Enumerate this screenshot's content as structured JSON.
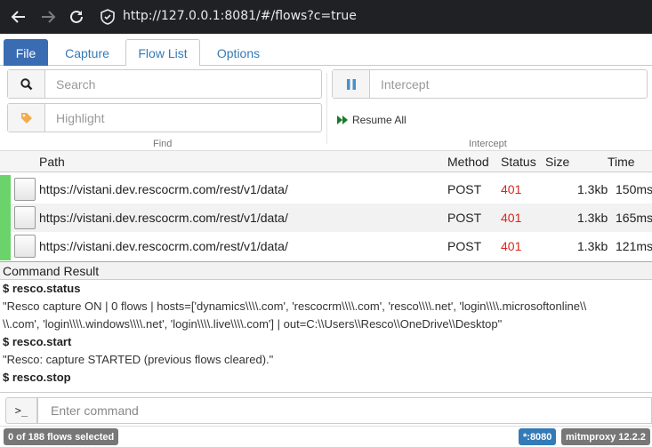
{
  "browser": {
    "url": "http://127.0.0.1:8081/#/flows?c=true"
  },
  "tabs": [
    {
      "label": "File"
    },
    {
      "label": "Capture"
    },
    {
      "label": "Flow List"
    },
    {
      "label": "Options"
    }
  ],
  "find": {
    "search_placeholder": "Search",
    "highlight_placeholder": "Highlight",
    "group_label": "Find"
  },
  "intercept": {
    "placeholder": "Intercept",
    "resume_label": "Resume All",
    "group_label": "Intercept"
  },
  "flows": {
    "columns": {
      "path": "Path",
      "method": "Method",
      "status": "Status",
      "size": "Size",
      "time": "Time"
    },
    "rows": [
      {
        "path": "https://vistani.dev.rescocrm.com/rest/v1/data/",
        "method": "POST",
        "status": "401",
        "size": "1.3kb",
        "time": "150ms"
      },
      {
        "path": "https://vistani.dev.rescocrm.com/rest/v1/data/",
        "method": "POST",
        "status": "401",
        "size": "1.3kb",
        "time": "165ms"
      },
      {
        "path": "https://vistani.dev.rescocrm.com/rest/v1/data/",
        "method": "POST",
        "status": "401",
        "size": "1.3kb",
        "time": "121ms"
      }
    ]
  },
  "command": {
    "header": "Command Result",
    "lines": [
      {
        "cmd": "$ resco.status"
      },
      {
        "text": "\"Resco capture ON | 0 flows | hosts=['dynamics\\\\\\\\.com', 'rescocrm\\\\\\\\.com', 'resco\\\\\\\\.net', 'login\\\\\\\\.microsoftonline\\\\"
      },
      {
        "text": "\\\\.com', 'login\\\\\\\\.windows\\\\\\\\.net', 'login\\\\\\\\.live\\\\\\\\.com'] | out=C:\\\\Users\\\\Resco\\\\OneDrive\\\\Desktop\""
      },
      {
        "cmd": "$ resco.start"
      },
      {
        "text": "\"Resco: capture STARTED (previous flows cleared).\""
      },
      {
        "cmd": "$ resco.stop"
      }
    ],
    "prompt": ">_",
    "input_placeholder": "Enter command"
  },
  "footer": {
    "selected": "0 of 188 flows selected",
    "listen": "*:8080",
    "version": "mitmproxy 12.2.2"
  },
  "colors": {
    "brand": "#396cb2",
    "status_error": "#d9261c",
    "marker": "#6bd36b"
  }
}
